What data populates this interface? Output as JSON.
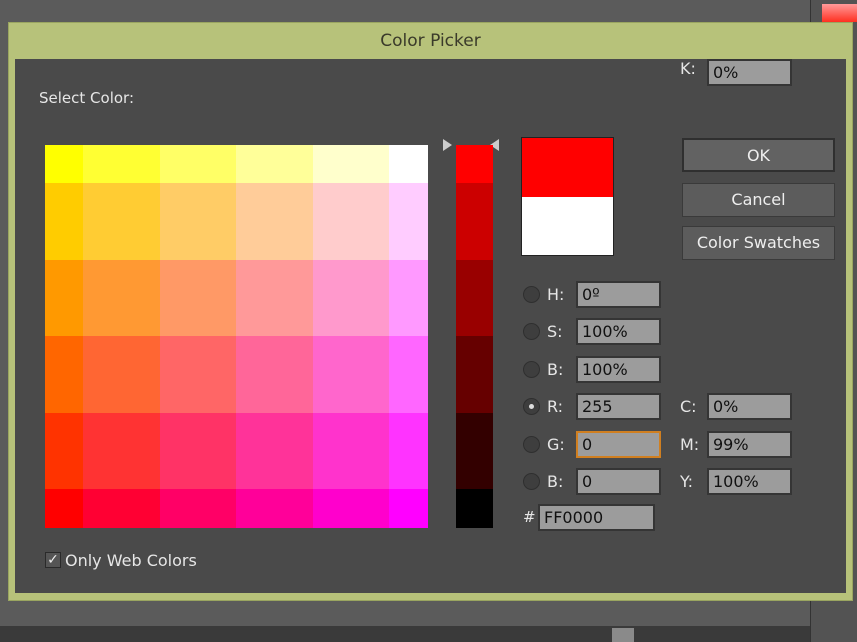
{
  "dialog": {
    "title": "Color Picker",
    "select_label": "Select Color:",
    "only_web_label": "Only Web Colors",
    "only_web_checked": true
  },
  "grid_colors": [
    [
      "#FFFF00",
      "#FFFF33",
      "#FFFF66",
      "#FFFF99",
      "#FFFFCC",
      "#FFFFFF"
    ],
    [
      "#FFCC00",
      "#FFCC33",
      "#FFCC66",
      "#FFCC99",
      "#FFCCCC",
      "#FFCCFF"
    ],
    [
      "#FF9900",
      "#FF9933",
      "#FF9966",
      "#FF9999",
      "#FF99CC",
      "#FF99FF"
    ],
    [
      "#FF6600",
      "#FF6633",
      "#FF6666",
      "#FF6699",
      "#FF66CC",
      "#FF66FF"
    ],
    [
      "#FF3300",
      "#FF3333",
      "#FF3366",
      "#FF3399",
      "#FF33CC",
      "#FF33FF"
    ],
    [
      "#FF0000",
      "#FF0033",
      "#FF0066",
      "#FF0099",
      "#FF00CC",
      "#FF00FF"
    ]
  ],
  "strip_colors": [
    "#FF0000",
    "#CC0000",
    "#990000",
    "#660000",
    "#330000",
    "#000000"
  ],
  "preview": {
    "new_color": "#FF0000",
    "current_color": "#FFFFFF"
  },
  "buttons": {
    "ok": "OK",
    "cancel": "Cancel",
    "swatches": "Color Swatches"
  },
  "hsb_rgb": [
    {
      "label": "H:",
      "value": "0º",
      "selected": false
    },
    {
      "label": "S:",
      "value": "100%",
      "selected": false
    },
    {
      "label": "B:",
      "value": "100%",
      "selected": false
    },
    {
      "label": "R:",
      "value": "255",
      "selected": true
    },
    {
      "label": "G:",
      "value": "0",
      "selected": false,
      "focused": true
    },
    {
      "label": "B:",
      "value": "0",
      "selected": false
    }
  ],
  "cmyk": [
    {
      "label": "C:",
      "value": "0%"
    },
    {
      "label": "M:",
      "value": "99%"
    },
    {
      "label": "Y:",
      "value": "100%"
    },
    {
      "label": "K:",
      "value": "0%"
    }
  ],
  "hex": {
    "label": "#",
    "value": "FF0000"
  },
  "colors": {
    "title_bar": "#B7C27A",
    "focus": "#D07F20"
  }
}
